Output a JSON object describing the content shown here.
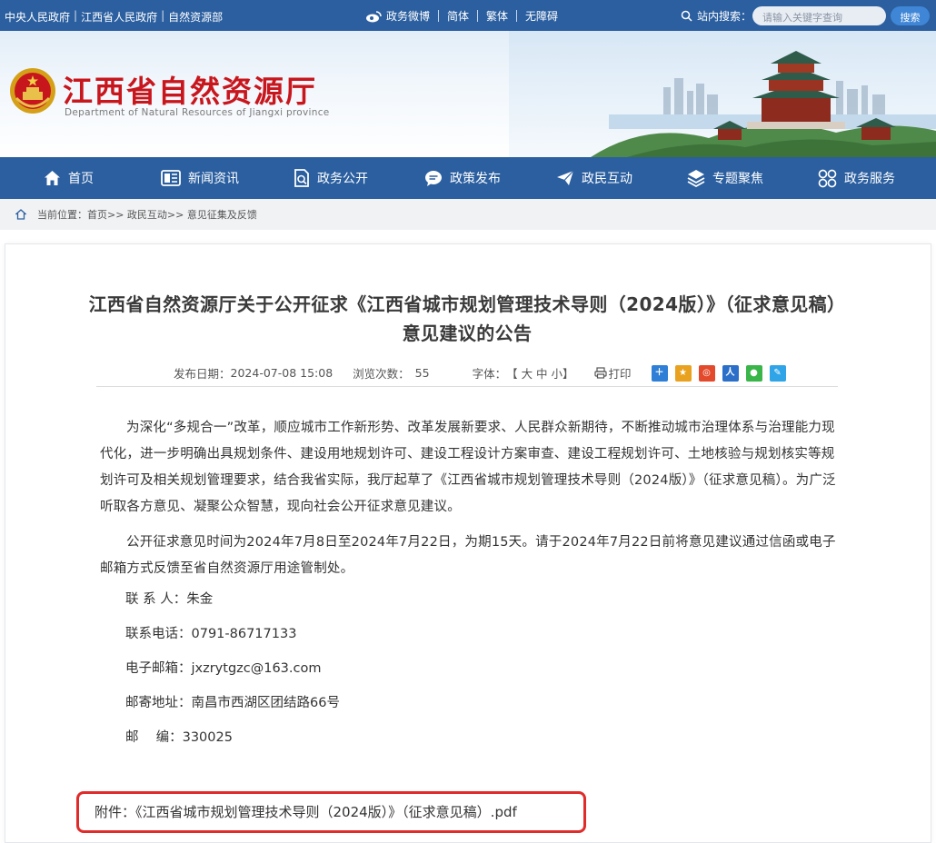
{
  "topbar": {
    "links": [
      "中央人民政府",
      "江西省人民政府",
      "自然资源部"
    ],
    "right_items": [
      "政务微博",
      "简体",
      "繁体",
      "无障碍"
    ],
    "search_label": "站内搜索：",
    "search_placeholder": "请输入关键字查询",
    "search_button": "搜索"
  },
  "banner": {
    "title": "江西省自然资源厅",
    "subtitle": "Department of Natural Resources of Jiangxi province"
  },
  "nav": {
    "items": [
      {
        "label": "首页",
        "icon": "home-icon"
      },
      {
        "label": "新闻资讯",
        "icon": "news-icon"
      },
      {
        "label": "政务公开",
        "icon": "document-icon"
      },
      {
        "label": "政策发布",
        "icon": "chat-bubble-icon"
      },
      {
        "label": "政民互动",
        "icon": "paper-plane-icon"
      },
      {
        "label": "专题聚焦",
        "icon": "layers-icon"
      },
      {
        "label": "政务服务",
        "icon": "grid-services-icon"
      }
    ]
  },
  "breadcrumb": {
    "label": "当前位置：",
    "path": "首页>> 政民互动>> 意见征集及反馈"
  },
  "article": {
    "title": "江西省自然资源厅关于公开征求《江西省城市规划管理技术导则（2024版）》（征求意见稿）意见建议的公告",
    "date_label": "发布日期：",
    "date": "2024-07-08 15:08",
    "views_label": "浏览次数：",
    "views": "55",
    "font_label": "字体：",
    "font_sizes": "【 大 中 小】",
    "print": "打印",
    "paragraph1": "为深化“多规合一”改革，顺应城市工作新形势、改革发展新要求、人民群众新期待，不断推动城市治理体系与治理能力现代化，进一步明确出具规划条件、建设用地规划许可、建设工程设计方案审查、建设工程规划许可、土地核验与规划核实等规划许可及相关规划管理要求，结合我省实际，我厅起草了《江西省城市规划管理技术导则（2024版）》（征求意见稿）。为广泛听取各方意见、凝聚公众智慧，现向社会公开征求意见建议。",
    "paragraph2": "公开征求意见时间为2024年7月8日至2024年7月22日，为期15天。请于2024年7月22日前将意见建议通过信函或电子邮箱方式反馈至省自然资源厅用途管制处。",
    "contact_person": "联 系 人：朱金",
    "phone": "联系电话：0791-86717133",
    "email": "电子邮箱：jxzrytgzc@163.com",
    "address": "邮寄地址：南昌市西湖区团结路66号",
    "postcode": "邮　 编：330025",
    "attachment": "附件：《江西省城市规划管理技术导则（2024版）》（征求意见稿）.pdf"
  },
  "colors": {
    "nav_blue": "#2b5fa0",
    "title_red": "#c8161d",
    "highlight_red": "#e02b2b"
  }
}
